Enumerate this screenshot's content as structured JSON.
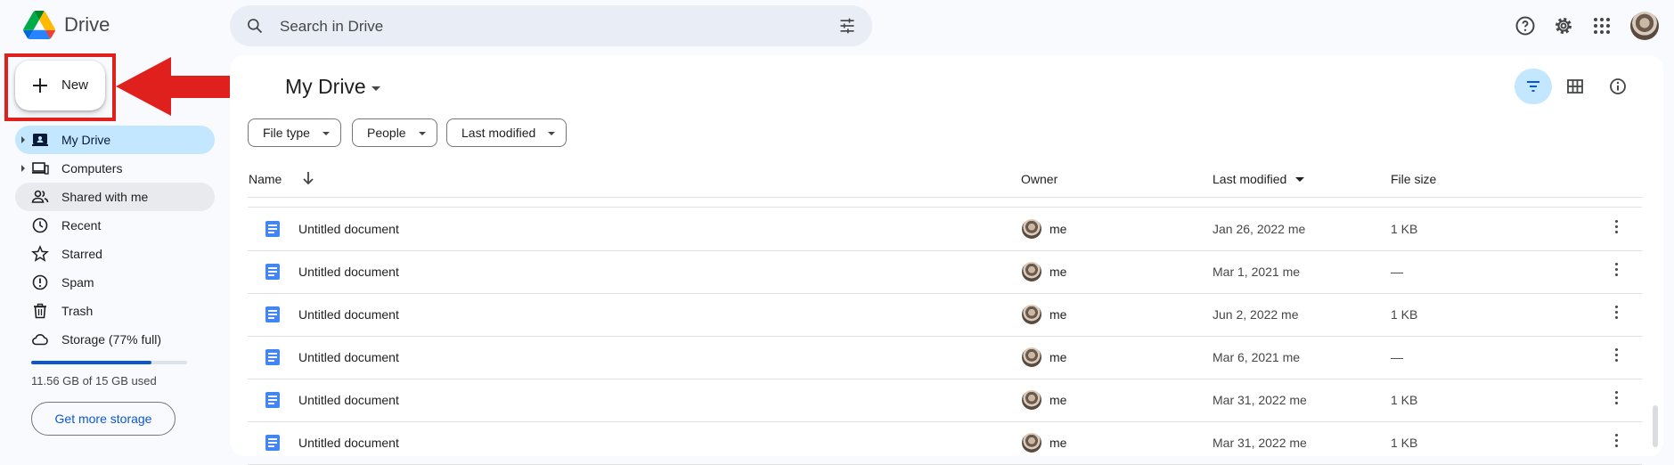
{
  "app": {
    "title": "Drive"
  },
  "search": {
    "placeholder": "Search in Drive"
  },
  "sidebar": {
    "new_label": "New",
    "items": [
      {
        "label": "My Drive",
        "icon": "my-drive-icon",
        "active": true,
        "expandable": true
      },
      {
        "label": "Computers",
        "icon": "computers-icon",
        "expandable": true
      },
      {
        "label": "Shared with me",
        "icon": "shared-icon",
        "hover": true
      },
      {
        "label": "Recent",
        "icon": "clock-icon"
      },
      {
        "label": "Starred",
        "icon": "star-icon"
      },
      {
        "label": "Spam",
        "icon": "spam-icon"
      },
      {
        "label": "Trash",
        "icon": "trash-icon"
      },
      {
        "label": "Storage (77% full)",
        "icon": "cloud-icon"
      }
    ],
    "storage_used_fraction": 0.77,
    "storage_text": "11.56 GB of 15 GB used",
    "get_more_storage": "Get more storage"
  },
  "main": {
    "title": "My Drive",
    "filters": [
      "File type",
      "People",
      "Last modified"
    ],
    "columns": {
      "name": "Name",
      "owner": "Owner",
      "modified": "Last modified",
      "size": "File size"
    },
    "rows": [
      {
        "name": "Untitled document",
        "owner": "me",
        "modified": "Jan 26, 2022 me",
        "size": "1 KB"
      },
      {
        "name": "Untitled document",
        "owner": "me",
        "modified": "Mar 1, 2021 me",
        "size": "—"
      },
      {
        "name": "Untitled document",
        "owner": "me",
        "modified": "Jun 2, 2022 me",
        "size": "1 KB"
      },
      {
        "name": "Untitled document",
        "owner": "me",
        "modified": "Mar 6, 2021 me",
        "size": "—"
      },
      {
        "name": "Untitled document",
        "owner": "me",
        "modified": "Mar 31, 2022 me",
        "size": "1 KB"
      },
      {
        "name": "Untitled document",
        "owner": "me",
        "modified": "Mar 31, 2022 me",
        "size": "1 KB"
      }
    ]
  },
  "colors": {
    "accent": "#0b57d0",
    "active_nav": "#c2e7ff",
    "annotation_red": "#e0201d",
    "doc_blue": "#4285f4"
  }
}
